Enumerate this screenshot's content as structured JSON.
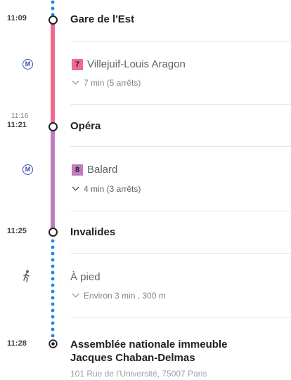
{
  "stops": [
    {
      "time": "11:09",
      "name": "Gare de l'Est"
    },
    {
      "time": "11:21",
      "scheduled_time": "11:16",
      "name": "Opéra"
    },
    {
      "time": "11:25",
      "name": "Invalides"
    },
    {
      "time": "11:28",
      "name_line1": "Assemblée nationale immeuble",
      "name_line2": "Jacques Chaban-Delmas",
      "address": "101 Rue de l'Université, 75007 Paris"
    }
  ],
  "legs": [
    {
      "mode_icon": "metro-icon",
      "mode_symbol": "M",
      "line": "7",
      "line_color": "#f06a8d",
      "direction": "Villejuif-Louis Aragon",
      "detail": "7 min (5 arrêts)"
    },
    {
      "mode_icon": "metro-icon",
      "mode_symbol": "M",
      "line": "8",
      "line_color": "#c07bbf",
      "direction": "Balard",
      "detail": "4 min (3 arrêts)"
    },
    {
      "mode_icon": "walk-icon",
      "mode": "À pied",
      "detail": "Environ 3 min , 300 m",
      "line_color": "#1e88e5"
    }
  ]
}
